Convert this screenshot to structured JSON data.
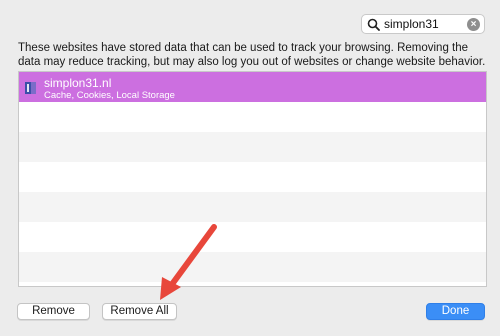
{
  "search": {
    "value": "simplon31"
  },
  "description": "These websites have stored data that can be used to track your browsing. Removing the data may reduce tracking, but may also log you out of websites or change website behavior.",
  "sites": [
    {
      "name": "simplon31.nl",
      "details": "Cache, Cookies, Local Storage",
      "selected": true
    }
  ],
  "buttons": {
    "remove": "Remove",
    "remove_all": "Remove All",
    "done": "Done"
  },
  "colors": {
    "selection": "#cc6fe0",
    "primary": "#3b8ef6",
    "arrow": "#e8473b"
  },
  "icons": {
    "search": "search-icon",
    "clear": "clear-search-icon",
    "site": "site-icon"
  }
}
